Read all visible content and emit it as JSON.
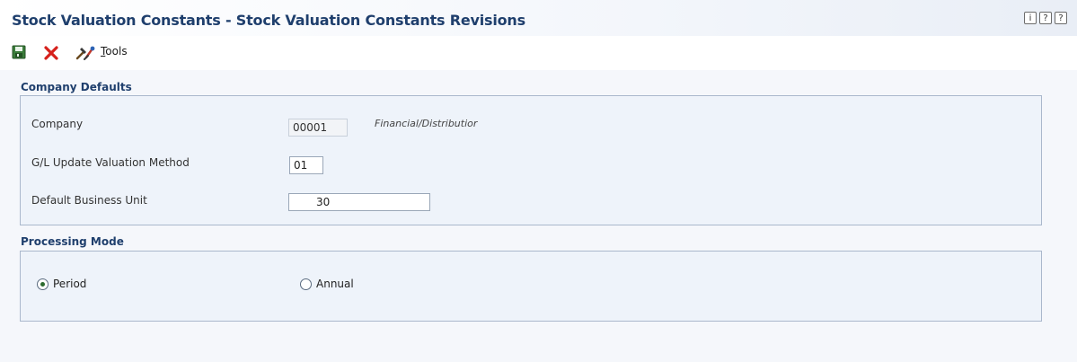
{
  "window": {
    "title": "Stock Valuation Constants - Stock Valuation Constants Revisions",
    "help_icons": [
      {
        "name": "info-icon",
        "glyph": "i"
      },
      {
        "name": "help-icon",
        "glyph": "?"
      },
      {
        "name": "context-help-icon",
        "glyph": "?"
      }
    ]
  },
  "toolbar": {
    "save_icon": "save-icon",
    "cancel_icon": "cancel-icon",
    "tools_icon": "tools-icon",
    "tools_label_first": "T",
    "tools_label_rest": "ools"
  },
  "company_defaults": {
    "title": "Company Defaults",
    "company_label": "Company",
    "company_value": "00001",
    "company_desc": "Financial/Distributior",
    "gl_label": "G/L Update Valuation Method",
    "gl_value": "01",
    "bu_label": "Default Business Unit",
    "bu_value": "30"
  },
  "processing_mode": {
    "title": "Processing Mode",
    "options": [
      {
        "label": "Period",
        "selected": true
      },
      {
        "label": "Annual",
        "selected": false
      }
    ]
  },
  "colors": {
    "title": "#1f3f6d",
    "panel_bg": "#eef3fa",
    "panel_border": "#aab8cc",
    "cancel_red": "#d6211c",
    "save_green": "#3b7d3b"
  }
}
